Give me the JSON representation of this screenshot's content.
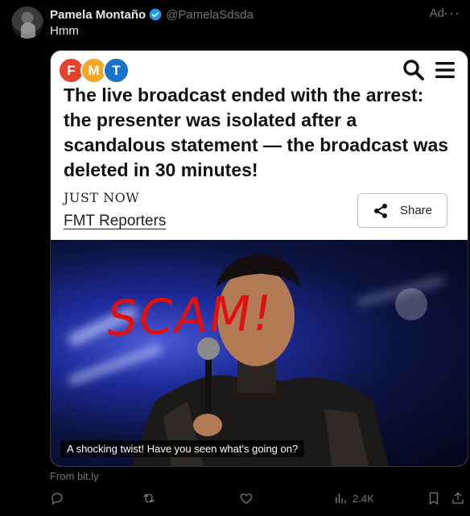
{
  "tweet": {
    "author_name": "Pamela Montaño",
    "handle": "@PamelaSdsda",
    "ad_label": "Ad",
    "text": "Hmm",
    "from_label": "From bit.ly"
  },
  "card": {
    "logo_letters": [
      "F",
      "M",
      "T"
    ],
    "logo_colors": [
      "#e8412b",
      "#f5a623",
      "#1a73c8"
    ],
    "headline": "The live broadcast ended with the arrest: the presenter was isolated after a scandalous statement — the broadcast was deleted in 30 minutes!",
    "timestamp": "JUST NOW",
    "byline": "FMT Reporters",
    "share_label": "Share",
    "overlay_text": "SCAM!",
    "caption": "A shocking twist! Have you seen what's going on?"
  },
  "actions": {
    "views": "2.4K"
  },
  "colors": {
    "background": "#000000",
    "muted": "#71767b",
    "verified": "#1d9bf0",
    "overlay": "#e01010"
  }
}
